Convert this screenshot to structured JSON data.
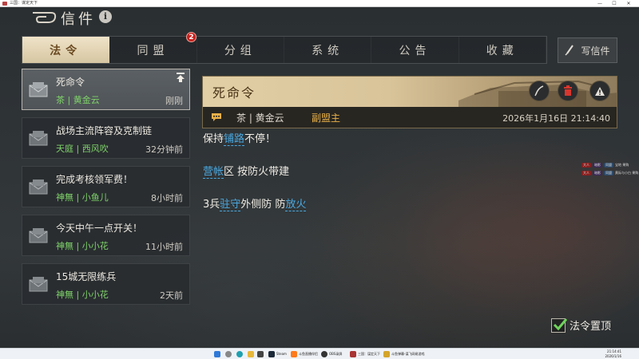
{
  "window": {
    "title": "三国：谋定天下",
    "controls": [
      "—",
      "☐",
      "✕"
    ]
  },
  "header": {
    "title": "信件",
    "info_label": "i"
  },
  "tabs": [
    {
      "label": "法令",
      "active": true
    },
    {
      "label": "同盟",
      "badge": "2"
    },
    {
      "label": "分组"
    },
    {
      "label": "系统"
    },
    {
      "label": "公告"
    },
    {
      "label": "收藏"
    }
  ],
  "write_button": {
    "label": "写信件"
  },
  "mails": [
    {
      "subject": "死命令",
      "sender": "茶 | 黄金云",
      "time": "刚刚",
      "active": true
    },
    {
      "subject": "战场主流阵容及克制链",
      "sender": "天庭 | 西风吹",
      "time": "32分钟前"
    },
    {
      "subject": "完成考核领军费！",
      "sender": "神無 | 小鱼儿",
      "time": "8小时前"
    },
    {
      "subject": "今天中午一点开关！",
      "sender": "神無 | 小小花",
      "time": "11小时前"
    },
    {
      "subject": "15城无限练兵",
      "sender": "神無 | 小小花",
      "time": "2天前"
    }
  ],
  "detail": {
    "title": "死命令",
    "sender": "茶 | 黄金云",
    "role": "副盟主",
    "date": "2026年1月16日  21:14:40"
  },
  "body": {
    "line1": {
      "pre": "保持",
      "hl": "铺路",
      "post": "不停！"
    },
    "line2": {
      "hl": "营帐",
      "post": "区 按防火带建"
    },
    "line3": {
      "pre": "3兵",
      "hl1": "驻守",
      "mid": "外侧防  防",
      "hl2": "放火"
    }
  },
  "side_chat": [
    {
      "a": "大人",
      "b": "暗影",
      "c": "同盟",
      "text": "宝地 果购"
    },
    {
      "a": "大人",
      "b": "暗影",
      "c": "同盟",
      "text": "黄际与小白 果购"
    }
  ],
  "pin_toggle": {
    "label": "法令置顶",
    "checked": true
  },
  "taskbar": {
    "items": [
      {
        "label": "Steam"
      },
      {
        "label": "斗鱼直播伴侣"
      },
      {
        "label": "OBS录屏"
      },
      {
        "label": "三国：谋定天下"
      },
      {
        "label": "斗鱼弹幕-谋飞网易游戏"
      }
    ],
    "time": "21:14:41",
    "date": "2026/1/16"
  },
  "colors": {
    "accent_gold": "#d6c6a2",
    "sender_green": "#7fd36a",
    "role_orange": "#e8b04a",
    "highlight_blue": "#4aa8e0",
    "badge_red": "#c8211d"
  },
  "icons": {
    "header_logo": "dragon-cloud-icon",
    "pin": "pin-top-icon",
    "mail": "envelope-icon",
    "write": "brush-icon",
    "reply": "quill-icon",
    "delete": "trash-icon",
    "report": "warning-icon",
    "chat": "speech-bubble-icon"
  }
}
